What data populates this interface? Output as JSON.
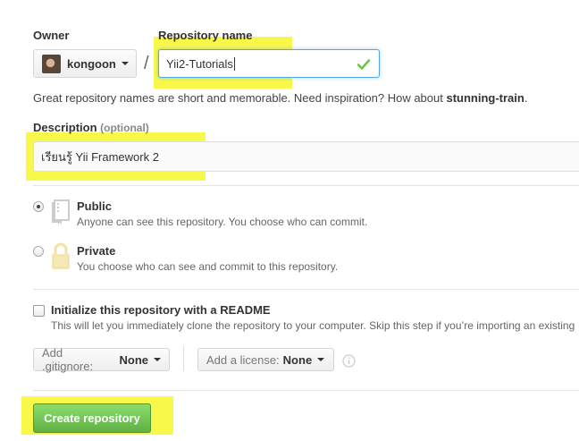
{
  "owner": {
    "label": "Owner",
    "value": "kongoon"
  },
  "separator": "/",
  "repo": {
    "label": "Repository name",
    "value": "Yii2-Tutorials"
  },
  "hint": {
    "text": "Great repository names are short and memorable. Need inspiration? How about ",
    "suggestion": "stunning-train",
    "end": "."
  },
  "description": {
    "label": "Description",
    "optional": "(optional)",
    "value": "เรียนรู้ Yii Framework 2"
  },
  "visibility": {
    "public": {
      "title": "Public",
      "desc": "Anyone can see this repository. You choose who can commit."
    },
    "private": {
      "title": "Private",
      "desc": "You choose who can see and commit to this repository."
    }
  },
  "readme": {
    "title": "Initialize this repository with a README",
    "desc": "This will let you immediately clone the repository to your computer. Skip this step if you’re importing an existing"
  },
  "gitignore": {
    "label": "Add .gitignore:",
    "value": "None"
  },
  "license": {
    "label": "Add a license:",
    "value": "None"
  },
  "create_button": "Create repository",
  "colors": {
    "accent_green": "#60b044",
    "focus_blue": "#51a7e8",
    "highlight": "#f7f84a"
  }
}
